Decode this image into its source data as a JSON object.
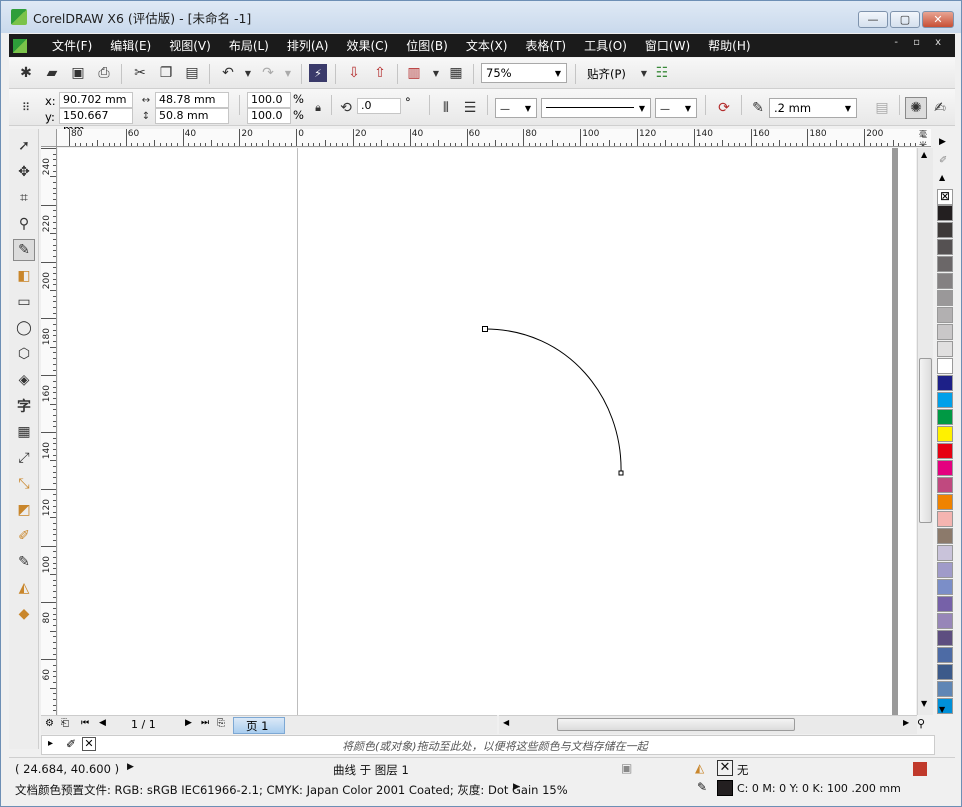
{
  "window": {
    "title": "CorelDRAW X6 (评估版) - [未命名 -1]",
    "min": "—",
    "max": "▢",
    "close": "✕"
  },
  "menu": [
    "文件(F)",
    "编辑(E)",
    "视图(V)",
    "布局(L)",
    "排列(A)",
    "效果(C)",
    "位图(B)",
    "文本(X)",
    "表格(T)",
    "工具(O)",
    "窗口(W)",
    "帮助(H)"
  ],
  "menu_right": "- ▫ x",
  "standard": {
    "zoom": "75%",
    "snap": "贴齐(P)"
  },
  "props": {
    "x_label": "x:",
    "x": "90.702 mm",
    "y_label": "y:",
    "y": "150.667 mm",
    "width": "48.78 mm",
    "height": "50.8 mm",
    "scale_x": "100.0",
    "scale_y": "100.0",
    "pct": "%",
    "rotation": ".0",
    "degree": "°",
    "outline_width": ".2 mm"
  },
  "ruler_h_labels": [
    "80",
    "60",
    "40",
    "20",
    "0",
    "20",
    "40",
    "60",
    "80",
    "100",
    "120",
    "140",
    "160",
    "180",
    "200"
  ],
  "ruler_h_unit": "毫米",
  "ruler_v_labels": [
    "240",
    "220",
    "200",
    "180",
    "160",
    "140",
    "120",
    "100",
    "80",
    "60"
  ],
  "page_nav": {
    "pages": "1 / 1",
    "tab": "页 1"
  },
  "hint": "将颜色(或对象)拖动至此处，以便将这些颜色与文档存储在一起",
  "status": {
    "coords": "( 24.684, 40.600 )",
    "object": "曲线 于 图层 1",
    "fill_label": "无",
    "profile": "文档颜色预置文件: RGB: sRGB IEC61966-2.1; CMYK: Japan Color 2001 Coated; 灰度: Dot Gain 15%",
    "outline_info": "C: 0 M: 0 Y: 0 K: 100  .200 mm"
  },
  "palette": [
    "#ffffff",
    "#231f20",
    "#3e3a39",
    "#555152",
    "#6b6768",
    "#848182",
    "#9a9899",
    "#b2b0b1",
    "#c9c7c8",
    "#e0dfdf",
    "#ffffff",
    "#1d2088",
    "#00a0e9",
    "#009944",
    "#fff100",
    "#e60012",
    "#e4007f",
    "#c0497f",
    "#f08300",
    "#f4b4b0",
    "#8c7a6b",
    "#c9c3da",
    "#a09bc9",
    "#7b8ec8",
    "#7661a8",
    "#9786b8",
    "#5d4e80",
    "#4d6ba5",
    "#3c5a8a",
    "#5f86b5",
    "#0090d8"
  ]
}
